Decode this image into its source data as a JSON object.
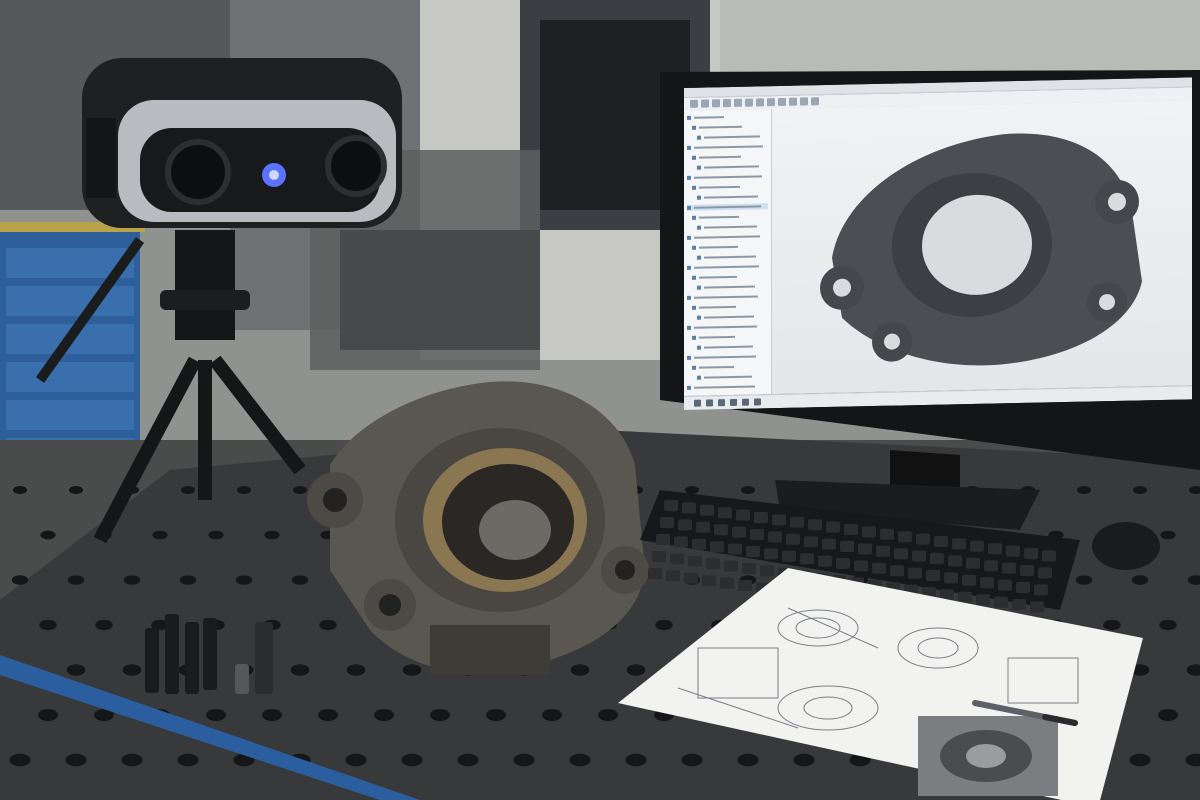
{
  "scene": {
    "description_kind": "photo",
    "colors": {
      "wall": "#bcbdb8",
      "cabinet": "#2f5f9a",
      "table": "#3a3b3c",
      "part": "#5a5650",
      "screen_bg": "#eceef1",
      "paper": "#f2f3f1",
      "scanner_body": "#1f2022",
      "scanner_trim": "#b8bcc1",
      "scanner_led": "#5b73ff"
    },
    "icons": [
      "scanner-icon",
      "monitor-icon",
      "keyboard-icon",
      "mouse-icon",
      "pen-icon",
      "drawing-sheet-icon"
    ]
  }
}
